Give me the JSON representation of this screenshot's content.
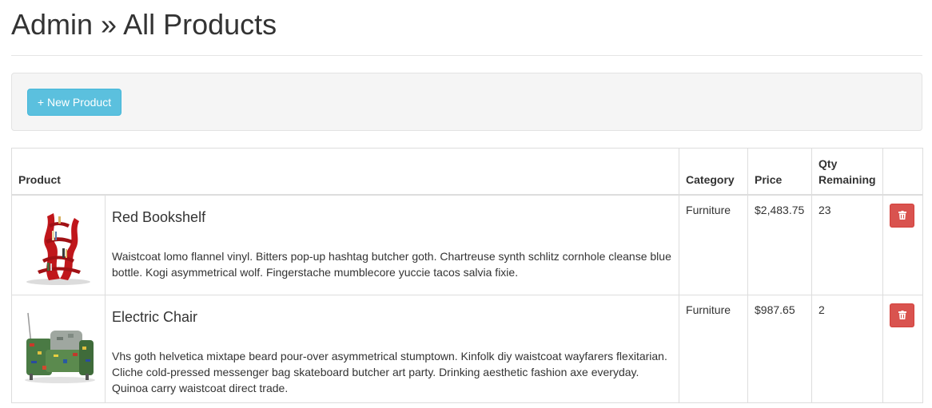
{
  "page": {
    "title": "Admin » All Products"
  },
  "toolbar": {
    "new_button_label": "+ New Product"
  },
  "table": {
    "headers": {
      "product": "Product",
      "category": "Category",
      "price": "Price",
      "qty": "Qty Remaining"
    },
    "rows": [
      {
        "name": "Red Bookshelf",
        "description": "Waistcoat lomo flannel vinyl. Bitters pop-up hashtag butcher goth. Chartreuse synth schlitz cornhole cleanse blue bottle. Kogi asymmetrical wolf. Fingerstache mumblecore yuccie tacos salvia fixie.",
        "category": "Furniture",
        "price": "$2,483.75",
        "qty": "23",
        "image_icon": "red-bookshelf-image"
      },
      {
        "name": "Electric Chair",
        "description": "Vhs goth helvetica mixtape beard pour-over asymmetrical stumptown. Kinfolk diy waistcoat wayfarers flexitarian. Cliche cold-pressed messenger bag skateboard butcher art party. Drinking aesthetic fashion axe everyday. Quinoa carry waistcoat direct trade.",
        "category": "Furniture",
        "price": "$987.65",
        "qty": "2",
        "image_icon": "electric-chair-image"
      }
    ],
    "delete_icon": "trash-icon"
  },
  "colors": {
    "info_button": "#5bc0de",
    "danger_button": "#d9534f",
    "bookshelf_red": "#c0161b"
  }
}
